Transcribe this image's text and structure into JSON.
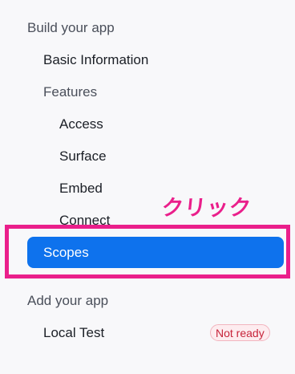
{
  "sidebar": {
    "build_section": {
      "title": "Build your app",
      "basic_information": "Basic Information",
      "features": {
        "label": "Features",
        "items": [
          "Access",
          "Surface",
          "Embed",
          "Connect"
        ]
      },
      "selected_item": "Scopes"
    },
    "add_section": {
      "title": "Add your app",
      "local_test": "Local Test",
      "local_test_status": "Not ready"
    }
  },
  "annotation": {
    "text": "クリック",
    "color": "#ea1f8b"
  },
  "colors": {
    "accent": "#0e72ed",
    "highlight": "#ea1f8b",
    "badge_text": "#c7243a",
    "background": "#f8f8fa"
  }
}
